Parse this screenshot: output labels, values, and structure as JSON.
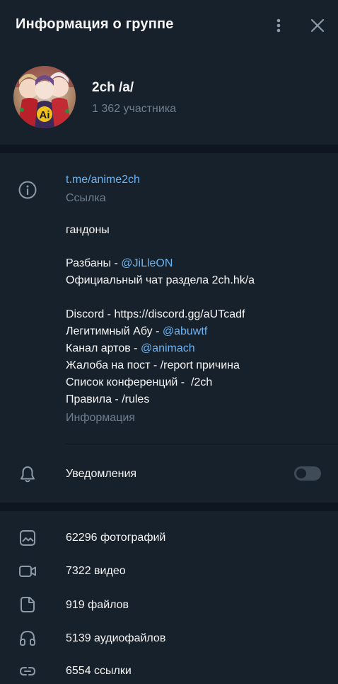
{
  "header": {
    "title": "Информация о группе",
    "menu_icon": "more-vertical-icon",
    "close_icon": "close-icon"
  },
  "group": {
    "name": "2ch /a/",
    "members": "1 362 участника"
  },
  "info": {
    "link": "t.me/anime2ch",
    "link_caption": "Ссылка",
    "description": {
      "line1": "гандоны",
      "line2_prefix": "Разбаны - ",
      "line2_mention": "@JiLleON",
      "line3": "Официальный чат раздела 2ch.hk/a",
      "line4": "Discord - https://discord.gg/aUTcadf",
      "line5_prefix": "Легитимный Абу - ",
      "line5_mention": "@abuwtf",
      "line6_prefix": "Канал артов - ",
      "line6_mention": "@animach",
      "line7": "Жалоба на пост - /report причина",
      "line8": "Список конференций -  /2ch",
      "line9": "Правила - /rules"
    },
    "description_caption": "Информация"
  },
  "notifications": {
    "label": "Уведомления",
    "enabled": false
  },
  "media": [
    {
      "label": "62296 фотографий",
      "icon": "photo-icon"
    },
    {
      "label": "7322 видео",
      "icon": "video-icon"
    },
    {
      "label": "919 файлов",
      "icon": "file-icon"
    },
    {
      "label": "5139 аудиофайлов",
      "icon": "headphones-icon"
    },
    {
      "label": "6554 ссылки",
      "icon": "link-icon"
    }
  ],
  "colors": {
    "background": "#17212b",
    "separator": "#0e1621",
    "accent": "#6ab3f3",
    "muted": "#6d7f8f",
    "icon": "#8c9aa7"
  }
}
